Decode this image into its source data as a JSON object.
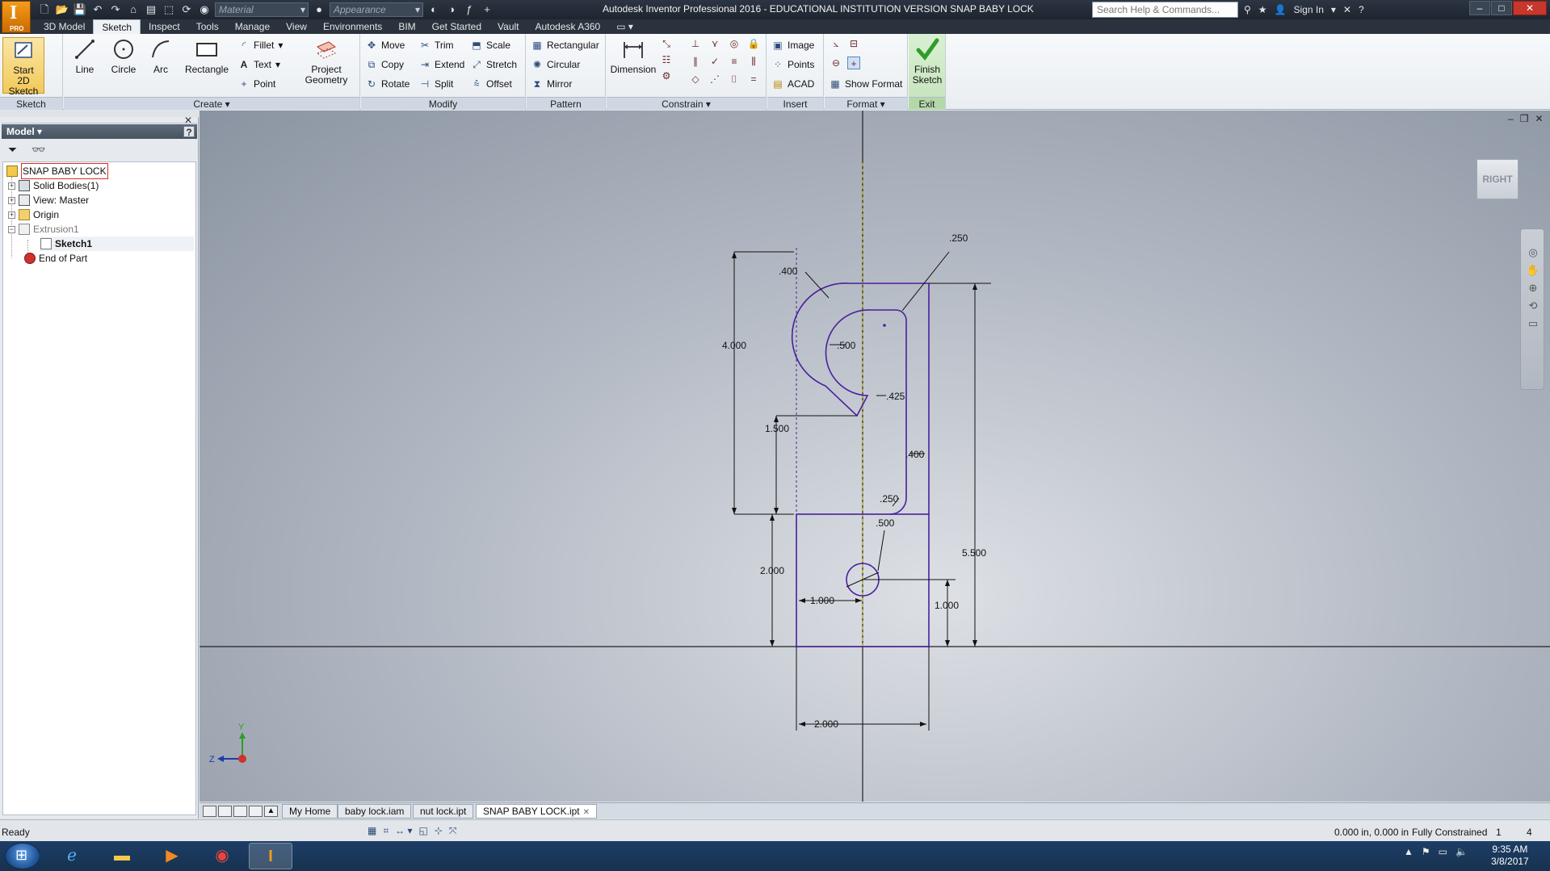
{
  "app": {
    "logo_text": "I",
    "logo_sub": "PRO",
    "title": "Autodesk Inventor Professional 2016 - EDUCATIONAL INSTITUTION VERSION   SNAP BABY LOCK",
    "material_placeholder": "Material",
    "appearance_placeholder": "Appearance",
    "search_placeholder": "Search Help & Commands...",
    "sign_in": "Sign In"
  },
  "ribbon_tabs": [
    "3D Model",
    "Sketch",
    "Inspect",
    "Tools",
    "Manage",
    "View",
    "Environments",
    "BIM",
    "Get Started",
    "Vault",
    "Autodesk A360"
  ],
  "active_tab": "Sketch",
  "ribbon": {
    "sketch": {
      "label": "Sketch",
      "start_line1": "Start",
      "start_line2": "2D Sketch"
    },
    "create": {
      "label": "Create ▾",
      "line": "Line",
      "circle": "Circle",
      "arc": "Arc",
      "rectangle": "Rectangle",
      "fillet": "Fillet",
      "text": "Text",
      "point": "Point",
      "project_line1": "Project",
      "project_line2": "Geometry"
    },
    "modify": {
      "label": "Modify",
      "move": "Move",
      "copy": "Copy",
      "rotate": "Rotate",
      "trim": "Trim",
      "extend": "Extend",
      "split": "Split",
      "scale": "Scale",
      "stretch": "Stretch",
      "offset": "Offset"
    },
    "pattern": {
      "label": "Pattern",
      "rectangular": "Rectangular",
      "circular": "Circular",
      "mirror": "Mirror"
    },
    "constrain": {
      "label": "Constrain ▾",
      "dimension": "Dimension"
    },
    "insert": {
      "label": "Insert",
      "image": "Image",
      "points": "Points",
      "acad": "ACAD"
    },
    "format": {
      "label": "Format ▾",
      "show_format": "Show Format"
    },
    "exit": {
      "label": "Exit",
      "finish_line1": "Finish",
      "finish_line2": "Sketch"
    }
  },
  "browser": {
    "title": "Model ▾",
    "help": "?",
    "tree": [
      {
        "label": "SNAP BABY LOCK"
      },
      {
        "label": "Solid Bodies(1)"
      },
      {
        "label": "View: Master"
      },
      {
        "label": "Origin"
      },
      {
        "label": "Extrusion1"
      },
      {
        "label": "Sketch1"
      },
      {
        "label": "End of Part"
      }
    ]
  },
  "viewport": {
    "viewcube_label": "RIGHT",
    "dimensions": {
      "d400_top": ".400",
      "d250_top": ".250",
      "d4000": "4.000",
      "d500_arc": ".500",
      "d425": ".425",
      "d1500": "1.500",
      "d400_right": ".400",
      "d250_mid": ".250",
      "d500_hole": ".500",
      "d2000_left": "2.000",
      "d5500": "5.500",
      "d1000_h": "1.000",
      "d1000_v": "1.000",
      "d2000_bottom": "2.000"
    },
    "triad": {
      "y": "Y",
      "z": "Z"
    }
  },
  "doc_tabs": [
    "My Home",
    "baby lock.iam",
    "nut lock.ipt",
    "SNAP BABY LOCK.ipt"
  ],
  "active_doc": "SNAP BABY LOCK.ipt",
  "status": {
    "ready": "Ready",
    "coords": "0.000 in, 0.000 in",
    "constraint": "Fully Constrained",
    "n1": "1",
    "n2": "4"
  },
  "taskbar": {
    "time": "9:35 AM",
    "date": "3/8/2017"
  },
  "colors": {
    "sketch_line": "#4a1f9c",
    "dimension": "#111111",
    "centerline": "#c7b800",
    "constraint_icon": "#6a2a2a",
    "finish_check": "#2e9c2a"
  }
}
